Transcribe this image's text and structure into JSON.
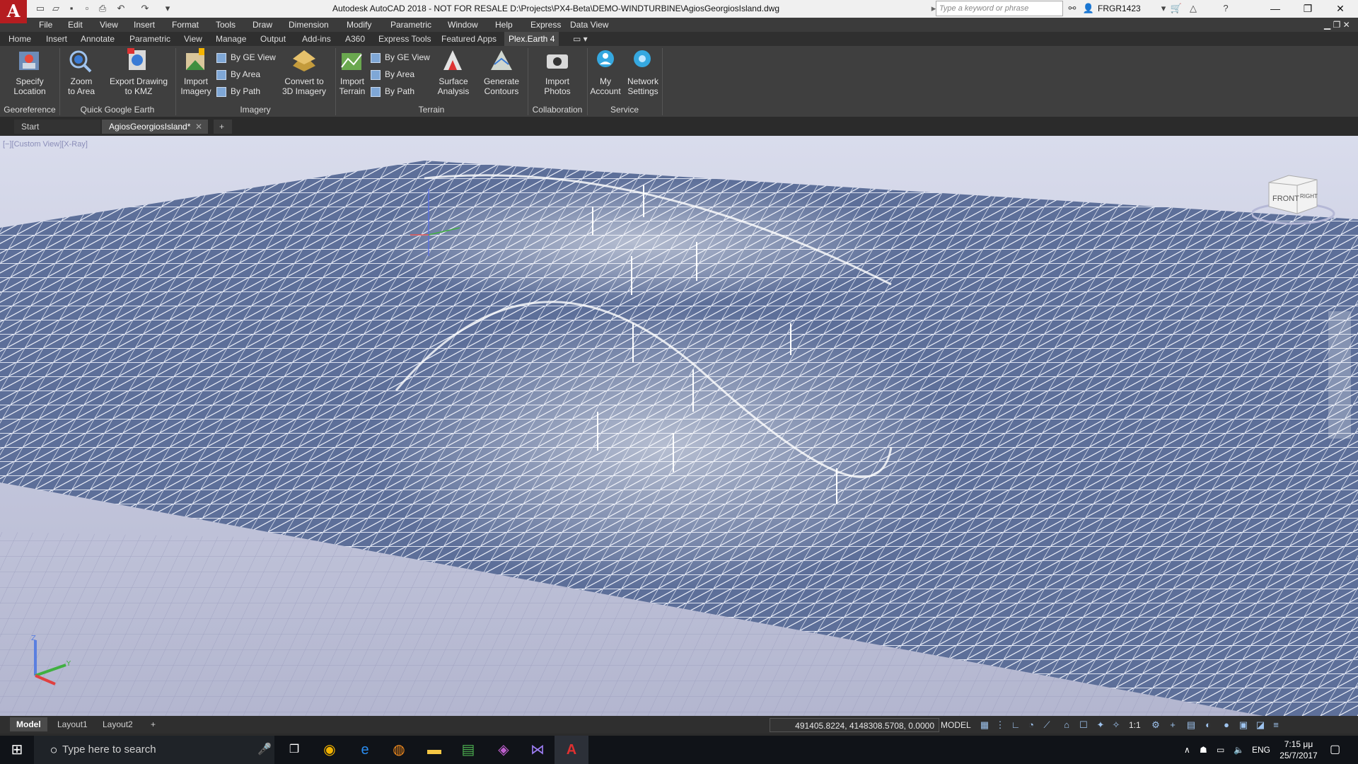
{
  "title_bar": {
    "app_logo": "A",
    "title": "Autodesk AutoCAD 2018 - NOT FOR RESALE    D:\\Projects\\PX4-Beta\\DEMO-WINDTURBINE\\AgiosGeorgiosIsland.dwg",
    "search_placeholder": "Type a keyword or phrase",
    "user": "FRGR1423"
  },
  "menu": [
    "File",
    "Edit",
    "View",
    "Insert",
    "Format",
    "Tools",
    "Draw",
    "Dimension",
    "Modify",
    "Parametric",
    "Window",
    "Help",
    "Express",
    "Data View"
  ],
  "ribbon_tabs": [
    "Home",
    "Insert",
    "Annotate",
    "Parametric",
    "View",
    "Manage",
    "Output",
    "Add-ins",
    "A360",
    "Express Tools",
    "Featured Apps",
    "Plex.Earth 4"
  ],
  "ribbon": {
    "georeference": {
      "title": "Georeference",
      "specify_location": "Specify\nLocation"
    },
    "quick_ge": {
      "title": "Quick Google Earth",
      "zoom_to_area": "Zoom\nto Area",
      "export_kmz": "Export Drawing\nto KMZ"
    },
    "imagery": {
      "title": "Imagery",
      "import_imagery": "Import\nImagery",
      "by_ge_view": "By GE View",
      "by_area": "By Area",
      "by_path": "By Path",
      "convert_3d": "Convert to\n3D Imagery"
    },
    "terrain": {
      "title": "Terrain",
      "import_terrain": "Import\nTerrain",
      "by_ge_view": "By GE View",
      "by_area": "By Area",
      "by_path": "By Path",
      "surface_analysis": "Surface\nAnalysis",
      "generate_contours": "Generate\nContours"
    },
    "collaboration": {
      "title": "Collaboration",
      "import_photos": "Import\nPhotos"
    },
    "service": {
      "title": "Service",
      "my_account": "My\nAccount",
      "network_settings": "Network\nSettings"
    }
  },
  "file_tabs": {
    "start": "Start",
    "drawing": "AgiosGeorgiosIsland*"
  },
  "viewport": {
    "label": "[−][Custom View][X-Ray]",
    "viewcube_front": "FRONT",
    "viewcube_right": "RIGHT"
  },
  "layout_tabs": [
    "Model",
    "Layout1",
    "Layout2"
  ],
  "status": {
    "coords": "491405.8224, 4148308.5708, 0.0000",
    "model": "MODEL",
    "scale": "1:1"
  },
  "taskbar": {
    "search": "Type here to search",
    "lang": "ENG",
    "time": "7:15 μμ",
    "date": "25/7/2017"
  },
  "colors": {
    "autocad_red": "#b51d20",
    "ribbon_bg": "#3f3f3f",
    "mesh_blue": "#6f81a8"
  }
}
